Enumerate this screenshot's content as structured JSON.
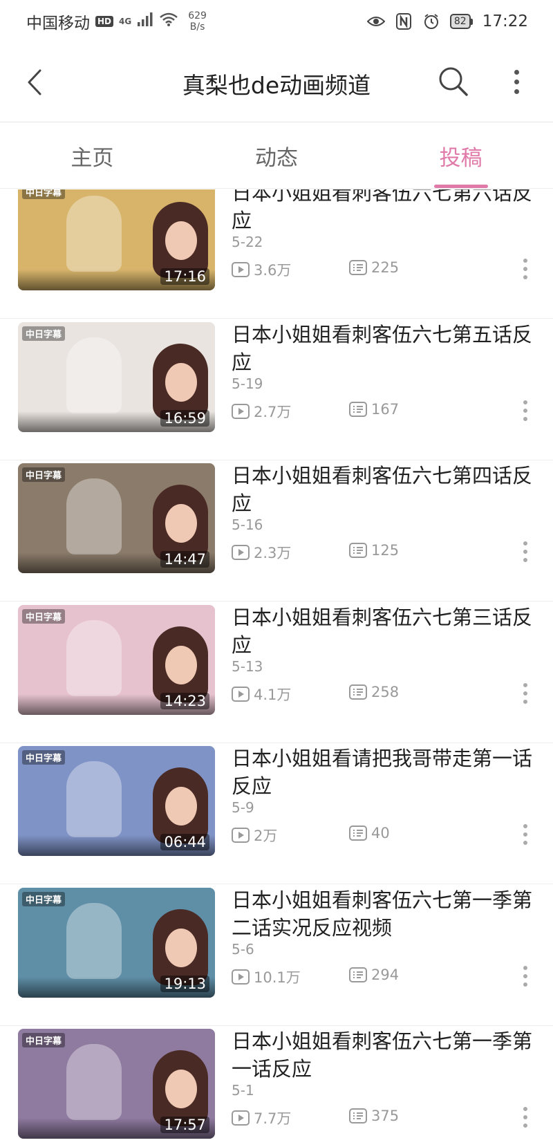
{
  "status_bar": {
    "carrier": "中国移动",
    "hd_badge": "HD",
    "signal": "4G",
    "speed": "629",
    "speed_unit": "B/s",
    "battery": "82",
    "time": "17:22"
  },
  "header": {
    "title": "真梨也de动画频道"
  },
  "tabs": [
    {
      "label": "主页",
      "active": false
    },
    {
      "label": "动态",
      "active": false
    },
    {
      "label": "投稿",
      "active": true
    }
  ],
  "accent_color": "#e07aa8",
  "videos": [
    {
      "title": "日本小姐姐看刺客伍六七第六话反应",
      "date": "5-22",
      "views": "3.6万",
      "comments": "225",
      "duration": "17:16",
      "subtitle_tag": "中日字幕",
      "thumb_color": "#d7b46a"
    },
    {
      "title": "日本小姐姐看刺客伍六七第五话反应",
      "date": "5-19",
      "views": "2.7万",
      "comments": "167",
      "duration": "16:59",
      "subtitle_tag": "中日字幕",
      "thumb_color": "#e9e4df"
    },
    {
      "title": "日本小姐姐看刺客伍六七第四话反应",
      "date": "5-16",
      "views": "2.3万",
      "comments": "125",
      "duration": "14:47",
      "subtitle_tag": "中日字幕",
      "thumb_color": "#8b7b6a"
    },
    {
      "title": "日本小姐姐看刺客伍六七第三话反应",
      "date": "5-13",
      "views": "4.1万",
      "comments": "258",
      "duration": "14:23",
      "subtitle_tag": "中日字幕",
      "thumb_color": "#e6c2cf"
    },
    {
      "title": "日本小姐姐看请把我哥带走第一话反应",
      "date": "5-9",
      "views": "2万",
      "comments": "40",
      "duration": "06:44",
      "subtitle_tag": "中日字幕",
      "thumb_color": "#7f93c6"
    },
    {
      "title": "日本小姐姐看刺客伍六七第一季第二话实况反应视频",
      "date": "5-6",
      "views": "10.1万",
      "comments": "294",
      "duration": "19:13",
      "subtitle_tag": "中日字幕",
      "thumb_color": "#5f8ea7"
    },
    {
      "title": "日本小姐姐看刺客伍六七第一季第一话反应",
      "date": "5-1",
      "views": "7.7万",
      "comments": "375",
      "duration": "17:57",
      "subtitle_tag": "中日字幕",
      "thumb_color": "#8f7aa0"
    }
  ]
}
